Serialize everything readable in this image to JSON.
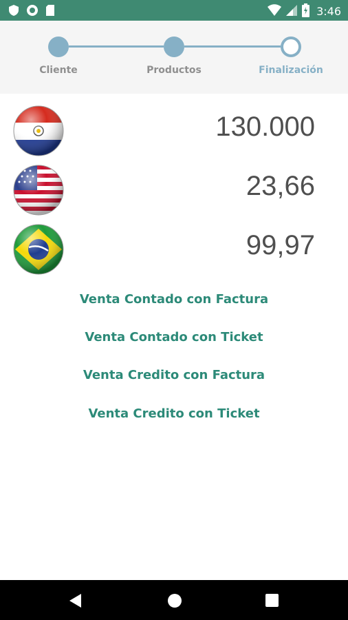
{
  "status_bar": {
    "time": "3:46",
    "left_icons": [
      "shield-icon",
      "sync-icon",
      "sd-card-icon"
    ],
    "right_icons": [
      "wifi-icon",
      "signal-icon",
      "battery-icon"
    ]
  },
  "stepper": {
    "steps": [
      {
        "label": "Cliente",
        "state": "done"
      },
      {
        "label": "Productos",
        "state": "done"
      },
      {
        "label": "Finalización",
        "state": "current"
      }
    ],
    "accent_color": "#86b0c6"
  },
  "currencies": [
    {
      "flag": "paraguay-flag-icon",
      "amount": "130.000"
    },
    {
      "flag": "usa-flag-icon",
      "amount": "23,66"
    },
    {
      "flag": "brazil-flag-icon",
      "amount": "99,97"
    }
  ],
  "actions": [
    {
      "label": "Venta Contado con Factura"
    },
    {
      "label": "Venta Contado con Ticket"
    },
    {
      "label": "Venta Credito con Factura"
    },
    {
      "label": "Venta Credito con Ticket"
    }
  ],
  "colors": {
    "status_bar": "#3f8a72",
    "action_text": "#2c8a78"
  },
  "nav_bar": {
    "buttons": [
      "back-icon",
      "home-icon",
      "recents-icon"
    ]
  }
}
